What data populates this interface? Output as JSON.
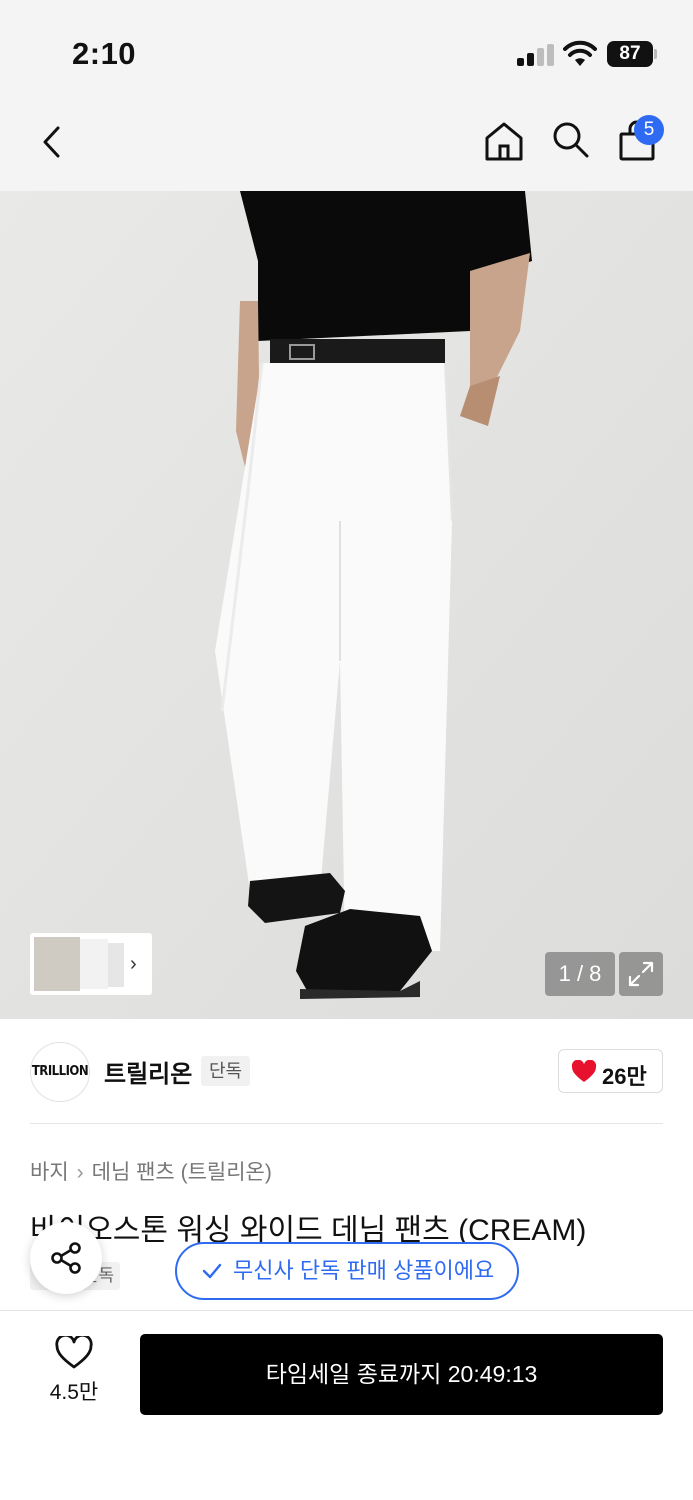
{
  "status_bar": {
    "time": "2:10",
    "battery": "87"
  },
  "nav": {
    "back_icon": "chevron-left-icon",
    "home_icon": "home-icon",
    "search_icon": "search-icon",
    "cart_icon": "shopping-bag-icon",
    "cart_count": "5"
  },
  "gallery": {
    "counter": "1 / 8",
    "expand_icon": "expand-icon",
    "thumb_next": "›"
  },
  "brand": {
    "logo_text": "TRILLION",
    "name": "트릴리온",
    "tag": "단독",
    "likes": "26만"
  },
  "product": {
    "breadcrumb": [
      "바지",
      "데님 팬츠 (트릴리온)"
    ],
    "title": "바이오스톤 워싱 와이드 데님 팬츠 (CREAM)",
    "sub_tag": "무신사단독",
    "exclusive_notice": "무신사 단독 판매 상품이에요"
  },
  "bottom_bar": {
    "wish_count": "4.5만",
    "buy_label": "타임세일 종료까지 20:49:13"
  },
  "colors": {
    "accent": "#2f6bf2",
    "heart": "#e8112d",
    "buy_button": "#000000"
  }
}
